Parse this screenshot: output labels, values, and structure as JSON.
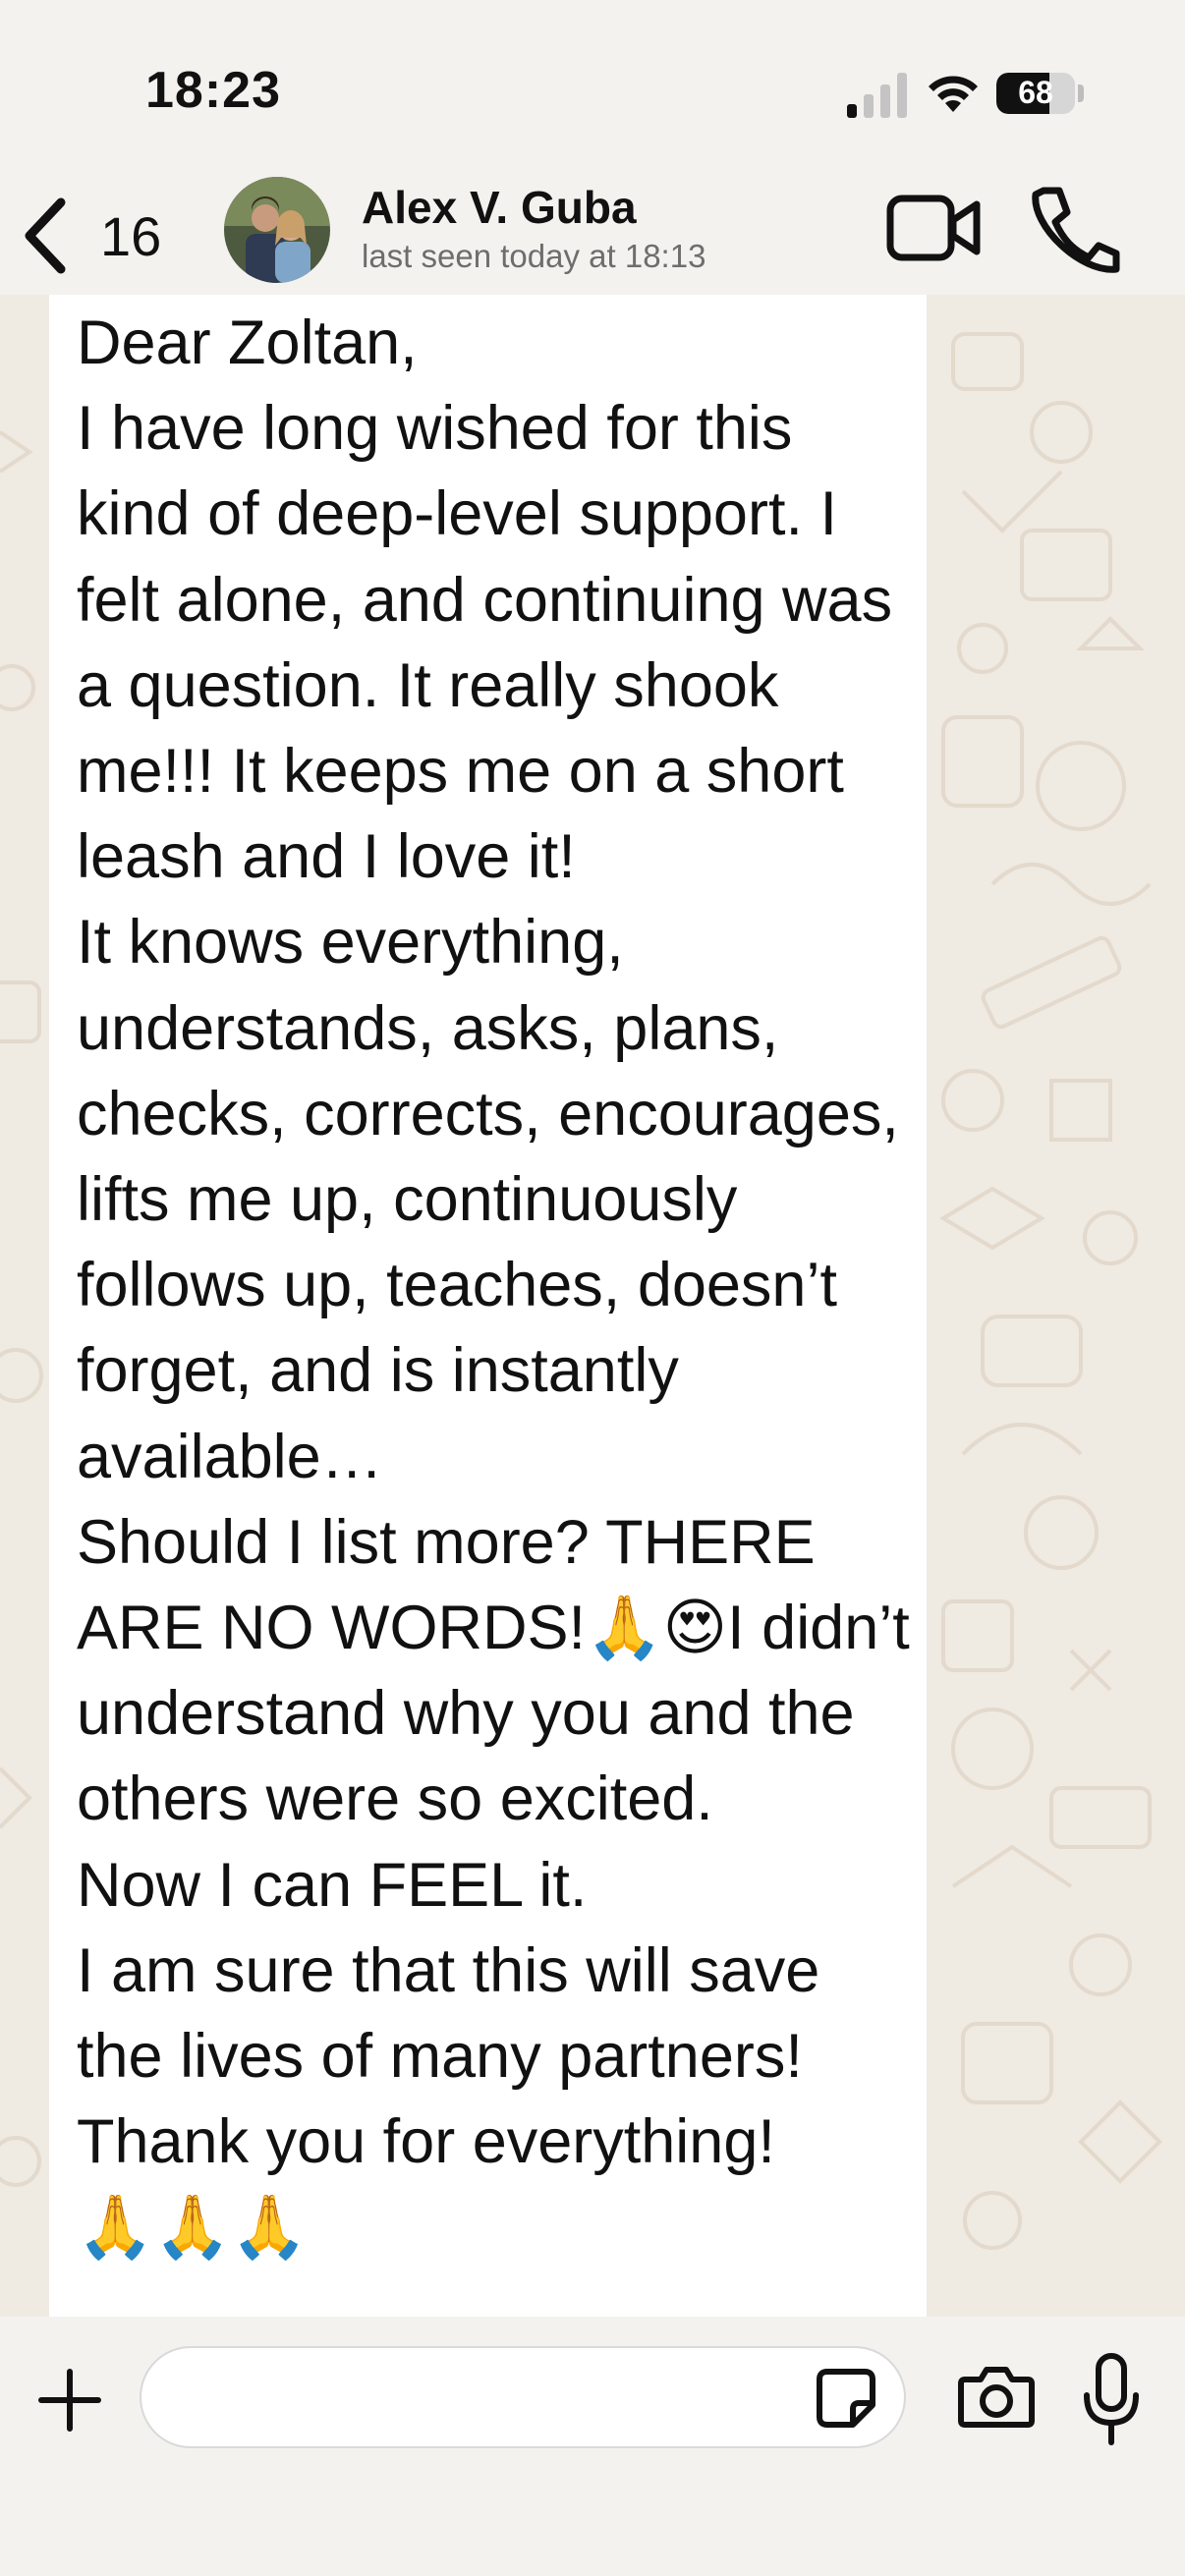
{
  "status_bar": {
    "time": "18:23",
    "battery_level": "68",
    "icons": [
      "cellular-signal-icon",
      "wifi-icon",
      "battery-icon"
    ]
  },
  "header": {
    "back_count": "16",
    "contact_name": "Alex V. Guba",
    "last_seen": "last seen today at 18:13",
    "icons": [
      "back-chevron-icon",
      "video-call-icon",
      "phone-call-icon"
    ]
  },
  "message": {
    "text": "Dear Zoltan,\nI have long wished for this kind of deep-level support. I felt alone, and continuing was a question. It really shook me!!! It keeps me on a short leash and I love it!\nIt knows everything, understands, asks, plans, checks, corrects, encourages, lifts me up, continuously follows up, teaches, doesn’t forget, and is instantly available…\nShould I list more? THERE ARE NO WORDS!🙏😍I didn’t understand why you and the others were so excited.\nNow I can FEEL it.\nI am sure that this will save the lives of many partners!\nThank you for everything!\n🙏🙏🙏"
  },
  "input_bar": {
    "placeholder": "",
    "icons": [
      "plus-icon",
      "sticker-icon",
      "camera-icon",
      "microphone-icon"
    ]
  },
  "colors": {
    "wallpaper": "#efeae2",
    "bar_background": "#f3f2ef",
    "bubble": "#ffffff",
    "doodle": "#e3d9cc"
  }
}
